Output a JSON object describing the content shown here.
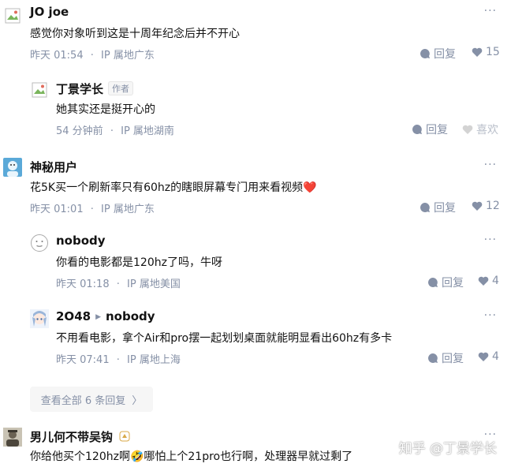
{
  "comments": [
    {
      "name": "JO joe",
      "text": "感觉你对象听到这是十周年纪念后并不开心",
      "time": "昨天 01:54",
      "ip": "IP 属地广东",
      "reply": "回复",
      "likes": "15"
    },
    {
      "name": "丁景学长",
      "badge": "作者",
      "text": "她其实还是挺开心的",
      "time": "54 分钟前",
      "ip": "IP 属地湖南",
      "reply": "回复",
      "likes": "喜欢"
    },
    {
      "name": "神秘用户",
      "text": "花5K买一个刷新率只有60hz的瞎眼屏幕专门用来看视频❤️",
      "time": "昨天 01:01",
      "ip": "IP 属地广东",
      "reply": "回复",
      "likes": "12"
    },
    {
      "name": "nobody",
      "text": "你看的电影都是120hz了吗，牛呀",
      "time": "昨天 01:18",
      "ip": "IP 属地美国",
      "reply": "回复",
      "likes": "4"
    },
    {
      "name": "2O48",
      "reply_to": "nobody",
      "text": "不用看电影，拿个Air和pro摆一起划划桌面就能明显看出60hz有多卡",
      "time": "昨天 07:41",
      "ip": "IP 属地上海",
      "reply": "回复",
      "likes": "4"
    },
    {
      "name": "男儿何不带吴钩",
      "text": "你给他买个120hz啊🤣哪怕上个21pro也行啊，处理器早就过剩了"
    }
  ],
  "show_all": "查看全部 6 条回复",
  "more_glyph": "···",
  "dot": "·",
  "watermark": "知乎 @丁景学长",
  "colors": {
    "meta": "#8590a6",
    "heart_liked": "#8590a6",
    "heart_empty": "#d3d3d3"
  }
}
